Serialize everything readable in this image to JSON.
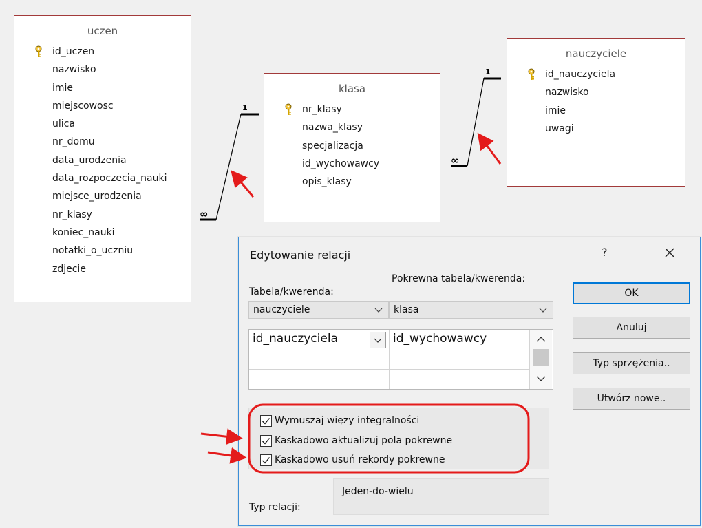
{
  "tables": {
    "uczen": {
      "title": "uczen",
      "fields": [
        "id_uczen",
        "nazwisko",
        "imie",
        "miejscowosc",
        "ulica",
        "nr_domu",
        "data_urodzenia",
        "data_rozpoczecia_nauki",
        "miejsce_urodzenia",
        "nr_klasy",
        "koniec_nauki",
        "notatki_o_uczniu",
        "zdjecie"
      ],
      "key_field": "id_uczen"
    },
    "klasa": {
      "title": "klasa",
      "fields": [
        "nr_klasy",
        "nazwa_klasy",
        "specjalizacja",
        "id_wychowawcy",
        "opis_klasy"
      ],
      "key_field": "nr_klasy"
    },
    "nauczyciele": {
      "title": "nauczyciele",
      "fields": [
        "id_nauczyciela",
        "nazwisko",
        "imie",
        "uwagi"
      ],
      "key_field": "id_nauczyciela"
    }
  },
  "relationships": [
    {
      "from_table": "klasa",
      "to_table": "uczen",
      "one_label": "1",
      "many_label": "∞"
    },
    {
      "from_table": "nauczyciele",
      "to_table": "klasa",
      "one_label": "1",
      "many_label": "∞"
    }
  ],
  "dialog": {
    "title": "Edytowanie relacji",
    "help": "?",
    "table_label": "Tabela/kwerenda:",
    "related_table_label": "Pokrewna tabela/kwerenda:",
    "table_value": "nauczyciele",
    "related_table_value": "klasa",
    "grid": {
      "left_field": "id_nauczyciela",
      "right_field": "id_wychowawcy"
    },
    "checkboxes": [
      {
        "label": "Wymuszaj więzy integralności",
        "checked": true
      },
      {
        "label": "Kaskadowo aktualizuj pola pokrewne",
        "checked": true
      },
      {
        "label": "Kaskadowo usuń rekordy pokrewne",
        "checked": true
      }
    ],
    "relation_type_label": "Typ relacji:",
    "relation_type_value": "Jeden-do-wielu",
    "buttons": {
      "ok": "OK",
      "cancel": "Anuluj",
      "join_type": "Typ sprzężenia..",
      "create_new": "Utwórz nowe.."
    }
  },
  "colors": {
    "table_border": "#a23a3a",
    "annotation_red": "#e41b1b",
    "dialog_border": "#3a8ed8",
    "primary_button_border": "#0078d7"
  }
}
